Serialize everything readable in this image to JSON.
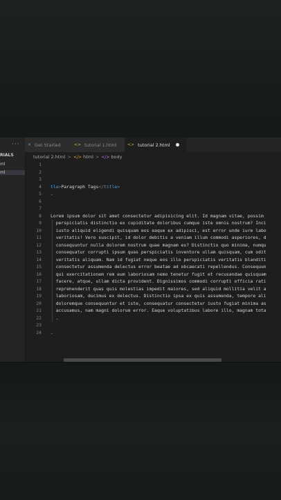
{
  "sidebar": {
    "more": "···",
    "title": "RIALS",
    "items": [
      {
        "label": "ml",
        "active": false
      },
      {
        "label": "ml",
        "active": true
      }
    ]
  },
  "tabs": [
    {
      "label": "Get Started",
      "icon": "vscode-icon",
      "active": false,
      "dirty": false
    },
    {
      "label": "tutorial 1.html",
      "icon": "html-file-icon",
      "active": false,
      "dirty": false
    },
    {
      "label": "tutorial 2.html",
      "icon": "html-file-icon",
      "active": true,
      "dirty": true
    }
  ],
  "breadcrumb": {
    "file": "tutorial 2.html",
    "sep": ">",
    "element1": "html",
    "element2": "body"
  },
  "code": {
    "lines": [
      {
        "n": "1",
        "text": ""
      },
      {
        "n": "2",
        "text": ""
      },
      {
        "n": "3",
        "text": ""
      },
      {
        "n": "4",
        "text": "tle>Paragraph Tags</title>"
      },
      {
        "n": "5",
        "text": "."
      },
      {
        "n": "6",
        "text": ""
      },
      {
        "n": "7",
        "text": ""
      },
      {
        "n": "8",
        "text": "Lorem ipsum dolor sit amet consectetur adipisicing elit. Id magnam vitae, possim"
      },
      {
        "n": "9",
        "text": "  perspiciatis distinctio ex cupiditate doloribus cumque iste omnis nostrum? Inci"
      },
      {
        "n": "10",
        "text": "  iusto aliquid eligendi quisquam eos eaque ex adipisci, est error unde iure labo"
      },
      {
        "n": "11",
        "text": "  veritatis! Vero suscipit, id dolor debitis a veniam illum commodi asperiores, d"
      },
      {
        "n": "12",
        "text": "  consequuntur nulla dolorem nostrum quae magnam ex? Distinctio quo minima, numqu"
      },
      {
        "n": "13",
        "text": "  consequatur corrupti ipsum quas perspiciatis inventore ullam quisquam, cum odit"
      },
      {
        "n": "14",
        "text": "  veritatis aliquam. Nam id fugiat neque eos illo perspiciatis veritatis blanditi"
      },
      {
        "n": "15",
        "text": "  consectetur assumenda delectus error beatae ad obcaecati repellendus. Consequun"
      },
      {
        "n": "16",
        "text": "  qui exercitationem rem eum laboriosam nemo tenetur fugit et recusandae quisquam"
      },
      {
        "n": "17",
        "text": "  facere, atque, ullam dicta provident. Dignissimos commodi corrupti officia rati"
      },
      {
        "n": "18",
        "text": "  reprehenderit quas quis molestias impedit maiores, sed aliquid mollitia velit a"
      },
      {
        "n": "19",
        "text": "  laboriosam, ducimus ex delectus. Distinctio ipsa ex quis assumenda, tempore ali"
      },
      {
        "n": "20",
        "text": "  doloremque consequuntur et iste, consequatur consectetur iusto fugiat minima as"
      },
      {
        "n": "21",
        "text": "  accusamus, nam magni dolorum error. Eaque voluptatibus labore illo, magnam tota"
      },
      {
        "n": "22",
        "text": "  ."
      },
      {
        "n": "23",
        "text": ""
      },
      {
        "n": "24",
        "text": "."
      }
    ]
  },
  "colors": {
    "tag": "#569cd6",
    "text": "#d4d4d4",
    "line_number": "#858585",
    "editor_bg": "#1e1e1e"
  }
}
